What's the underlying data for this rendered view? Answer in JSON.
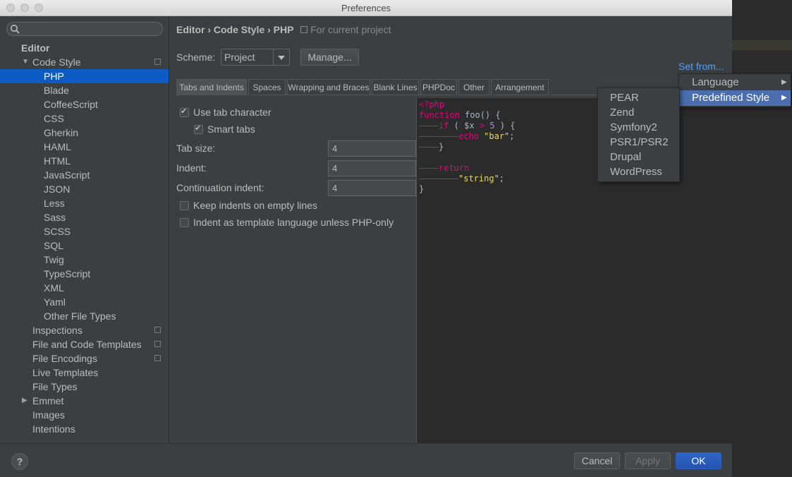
{
  "window": {
    "title": "Preferences"
  },
  "sidebar": {
    "search_placeholder": "",
    "items": [
      {
        "label": "Editor",
        "level": 0,
        "bold": true
      },
      {
        "label": "Code Style",
        "level": 1,
        "expanded": true,
        "copy": true
      },
      {
        "label": "PHP",
        "level": 2,
        "selected": true
      },
      {
        "label": "Blade",
        "level": 2
      },
      {
        "label": "CoffeeScript",
        "level": 2
      },
      {
        "label": "CSS",
        "level": 2
      },
      {
        "label": "Gherkin",
        "level": 2
      },
      {
        "label": "HAML",
        "level": 2
      },
      {
        "label": "HTML",
        "level": 2
      },
      {
        "label": "JavaScript",
        "level": 2
      },
      {
        "label": "JSON",
        "level": 2
      },
      {
        "label": "Less",
        "level": 2
      },
      {
        "label": "Sass",
        "level": 2
      },
      {
        "label": "SCSS",
        "level": 2
      },
      {
        "label": "SQL",
        "level": 2
      },
      {
        "label": "Twig",
        "level": 2
      },
      {
        "label": "TypeScript",
        "level": 2
      },
      {
        "label": "XML",
        "level": 2
      },
      {
        "label": "Yaml",
        "level": 2
      },
      {
        "label": "Other File Types",
        "level": 2
      },
      {
        "label": "Inspections",
        "level": 1,
        "copy": true
      },
      {
        "label": "File and Code Templates",
        "level": 1,
        "copy": true
      },
      {
        "label": "File Encodings",
        "level": 1,
        "copy": true
      },
      {
        "label": "Live Templates",
        "level": 1
      },
      {
        "label": "File Types",
        "level": 1
      },
      {
        "label": "Emmet",
        "level": 1,
        "collapsed": true
      },
      {
        "label": "Images",
        "level": 1
      },
      {
        "label": "Intentions",
        "level": 1
      }
    ]
  },
  "breadcrumb": {
    "path": "Editor › Code Style › PHP",
    "scope": "For current project"
  },
  "scheme": {
    "label": "Scheme:",
    "value": "Project",
    "manage": "Manage..."
  },
  "set_from": "Set from...",
  "tabs": [
    "Tabs and Indents",
    "Spaces",
    "Wrapping and Braces",
    "Blank Lines",
    "PHPDoc",
    "Other",
    "Arrangement"
  ],
  "options": {
    "use_tab": {
      "label": "Use tab character",
      "checked": true
    },
    "smart_tabs": {
      "label": "Smart tabs",
      "checked": true
    },
    "tab_size": {
      "label": "Tab size:",
      "value": "4"
    },
    "indent": {
      "label": "Indent:",
      "value": "4"
    },
    "cont_indent": {
      "label": "Continuation indent:",
      "value": "4"
    },
    "keep_indents": {
      "label": "Keep indents on empty lines",
      "checked": false
    },
    "template_lang": {
      "label": "Indent as template language unless PHP-only",
      "checked": false
    }
  },
  "code": {
    "open_tag": "<?php",
    "function_kw": "function",
    "function_sig": " foo() {",
    "if_kw": "if",
    "if_open": " ( ",
    "var": "$x",
    "op": " > ",
    "num": "5",
    "if_close": " ) {",
    "echo_kw": "echo",
    "echo_str": "\"bar\"",
    "semi": ";",
    "close_brace": "}",
    "return_kw": "return",
    "return_str": "\"string\"",
    "final_brace": "}"
  },
  "menu": {
    "items": [
      {
        "label": "Language",
        "arrow": "▶"
      },
      {
        "label": "Predefined Style",
        "arrow": "▶",
        "highlighted": true
      }
    ],
    "submenu": [
      "PEAR",
      "Zend",
      "Symfony2",
      "PSR1/PSR2",
      "Drupal",
      "WordPress"
    ]
  },
  "footer": {
    "help": "?",
    "cancel": "Cancel",
    "apply": "Apply",
    "ok": "OK"
  }
}
